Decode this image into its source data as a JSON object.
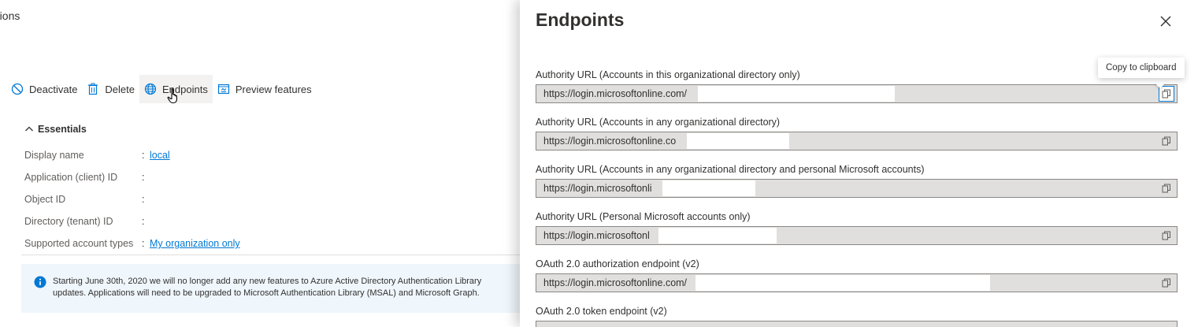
{
  "page": {
    "title_fragment": "ations"
  },
  "toolbar": {
    "deactivate_label": "Deactivate",
    "delete_label": "Delete",
    "endpoints_label": "Endpoints",
    "preview_label": "Preview features"
  },
  "essentials": {
    "heading": "Essentials",
    "rows": [
      {
        "label": "Display name",
        "colon": ":",
        "value": "local"
      },
      {
        "label": "Application (client) ID",
        "colon": ":",
        "value": ""
      },
      {
        "label": "Object ID",
        "colon": ":",
        "value": ""
      },
      {
        "label": "Directory (tenant) ID",
        "colon": ":",
        "value": ""
      },
      {
        "label": "Supported account types",
        "colon": ":",
        "value": "My organization only"
      }
    ]
  },
  "info_banner": {
    "line1": "Starting June 30th, 2020 we will no longer add any new features to Azure Active Directory Authentication Library",
    "line2": "updates. Applications will need to be upgraded to Microsoft Authentication Library (MSAL) and Microsoft Graph."
  },
  "panel": {
    "title": "Endpoints",
    "tooltip": "Copy to clipboard",
    "fields": [
      {
        "label": "Authority URL (Accounts in this organizational directory only)",
        "value": "https://login.microsoftonline.com/"
      },
      {
        "label": "Authority URL (Accounts in any organizational directory)",
        "value": "https://login.microsoftonline.co"
      },
      {
        "label": "Authority URL (Accounts in any organizational directory and personal Microsoft accounts)",
        "value": "https://login.microsoftonli"
      },
      {
        "label": "Authority URL (Personal Microsoft accounts only)",
        "value": "https://login.microsoftonl"
      },
      {
        "label": "OAuth 2.0 authorization endpoint (v2)",
        "value": "https://login.microsoftonline.com/"
      },
      {
        "label": "OAuth 2.0 token endpoint (v2)",
        "value": ""
      }
    ]
  },
  "colors": {
    "accent": "#0078d4",
    "field_bg": "#e1dfdd",
    "info_bg": "#eff6fc"
  },
  "icons": [
    "deactivate-icon",
    "delete-icon",
    "globe-icon",
    "preview-features-icon",
    "chevron-up-icon",
    "info-icon",
    "close-icon",
    "copy-icon",
    "hand-cursor-icon"
  ]
}
